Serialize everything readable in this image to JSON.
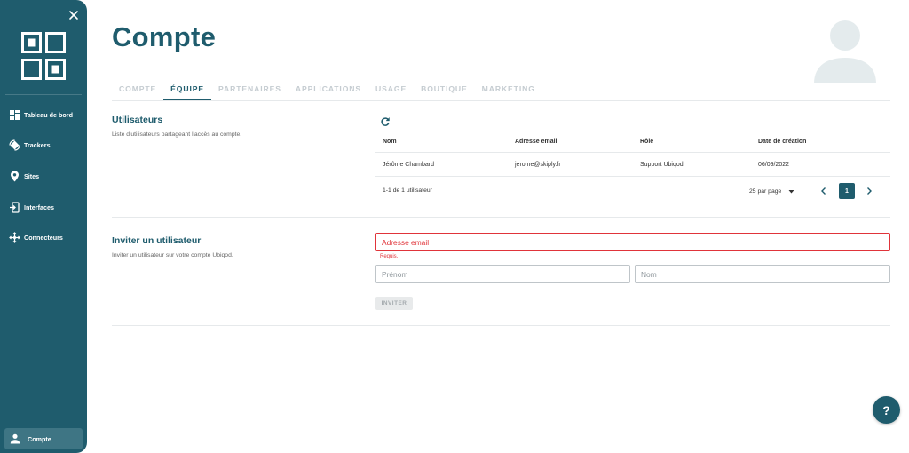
{
  "app": {
    "accent_color": "#1f5c6d",
    "error_color": "#e0343a"
  },
  "sidebar": {
    "close_icon": "close-icon",
    "logo_icon": "qr-grid-logo",
    "items": [
      {
        "label": "Tableau de bord",
        "icon": "dashboard-icon"
      },
      {
        "label": "Trackers",
        "icon": "tracker-icon"
      },
      {
        "label": "Sites",
        "icon": "location-pin-icon"
      },
      {
        "label": "Interfaces",
        "icon": "interface-icon"
      },
      {
        "label": "Connecteurs",
        "icon": "connector-icon"
      }
    ],
    "account": {
      "label": "Compte",
      "icon": "user-icon"
    }
  },
  "header": {
    "title": "Compte",
    "avatar_icon": "user-avatar-icon"
  },
  "tabs": [
    {
      "label": "COMPTE",
      "active": false
    },
    {
      "label": "ÉQUIPE",
      "active": true
    },
    {
      "label": "PARTENAIRES",
      "active": false
    },
    {
      "label": "APPLICATIONS",
      "active": false
    },
    {
      "label": "USAGE",
      "active": false
    },
    {
      "label": "BOUTIQUE",
      "active": false
    },
    {
      "label": "MARKETING",
      "active": false
    }
  ],
  "users_section": {
    "title": "Utilisateurs",
    "description": "Liste d'utilisateurs partageant l'accès au compte.",
    "refresh_icon": "refresh-icon",
    "columns": [
      "Nom",
      "Adresse email",
      "Rôle",
      "Date de création"
    ],
    "rows": [
      {
        "name": "Jérôme Chambard",
        "email": "jerome@skiply.fr",
        "role": "Support Ubiqod",
        "created": "06/09/2022"
      }
    ],
    "pagination": {
      "count_text": "1-1 de 1 utilisateur",
      "per_page": "25 par page",
      "current_page": "1"
    }
  },
  "invite_section": {
    "title": "Inviter un utilisateur",
    "description": "Inviter un utilisateur sur votre compte Ubiqod.",
    "email_placeholder": "Adresse email",
    "email_error": "Requis.",
    "firstname_placeholder": "Prénom",
    "lastname_placeholder": "Nom",
    "invite_label": "INVITER"
  },
  "help": {
    "label": "?"
  }
}
